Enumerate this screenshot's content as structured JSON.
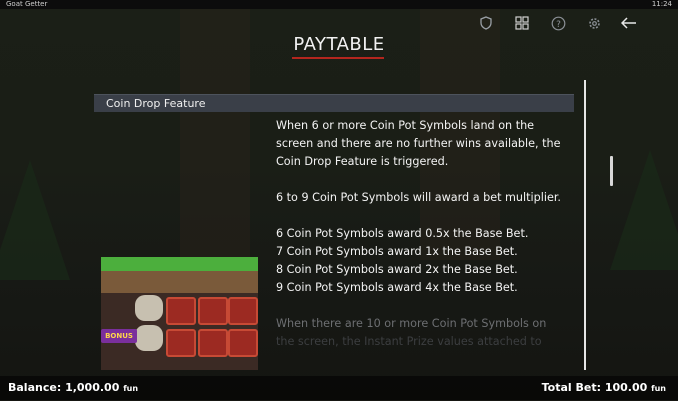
{
  "window": {
    "app_title": "Goat Getter",
    "clock": "11:24"
  },
  "toolbar": {
    "icons": [
      "shield-icon",
      "grid-icon",
      "help-icon",
      "settings-icon",
      "back-arrow-icon"
    ]
  },
  "page": {
    "title": "PAYTABLE"
  },
  "section": {
    "header": "Coin Drop Feature",
    "paragraphs": [
      "When 6 or more Coin Pot Symbols land on the screen and there are no further wins available, the Coin Drop Feature is triggered.",
      "6 to 9 Coin Pot Symbols will award a bet multiplier."
    ],
    "awards": [
      "6 Coin Pot Symbols award 0.5x the Base Bet.",
      "7 Coin Pot Symbols award 1x the Base Bet.",
      "8 Coin Pot Symbols award 2x the Base Bet.",
      "9 Coin Pot Symbols award 4x the Base Bet."
    ],
    "faded_line_1": "When there are 10 or more Coin Pot Symbols on",
    "faded_line_2": "the screen, the Instant Prize values attached to"
  },
  "illustration": {
    "bonus_label": "BONUS"
  },
  "footer": {
    "balance_label": "Balance:",
    "balance_value": "1,000.00",
    "balance_unit": "fun",
    "bet_label": "Total Bet:",
    "bet_value": "100.00",
    "bet_unit": "fun"
  },
  "colors": {
    "accent_underline": "#b3261e",
    "section_header_bg": "#3a3f48"
  }
}
